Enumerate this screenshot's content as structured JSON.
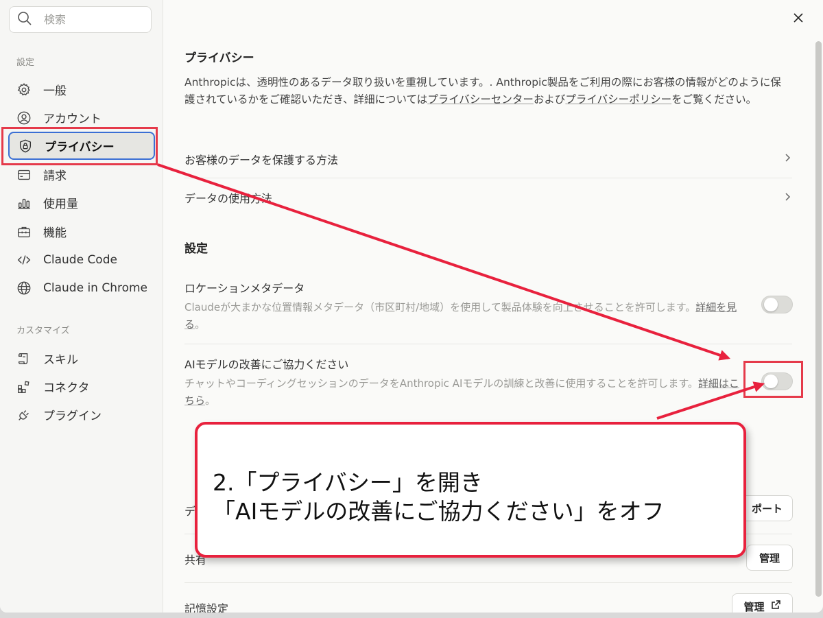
{
  "sidebar": {
    "search_placeholder": "検索",
    "section_settings": "設定",
    "items": [
      {
        "label": "一般"
      },
      {
        "label": "アカウント"
      },
      {
        "label": "プライバシー"
      },
      {
        "label": "請求"
      },
      {
        "label": "使用量"
      },
      {
        "label": "機能"
      },
      {
        "label": "Claude Code"
      },
      {
        "label": "Claude in Chrome"
      }
    ],
    "section_customize": "カスタマイズ",
    "custom_items": [
      {
        "label": "スキル"
      },
      {
        "label": "コネクタ"
      },
      {
        "label": "プラグイン"
      }
    ]
  },
  "privacy": {
    "title": "プライバシー",
    "intro_1": "Anthropicは、透明性のあるデータ取り扱いを重視しています。. Anthropic製品をご利用の際にお客様の情報がどのように保護されているかをご確認いただき、詳細については",
    "link_center": "プライバシーセンター",
    "intro_2": "および",
    "link_policy": "プライバシーポリシー",
    "intro_3": "をご覧ください。",
    "row_protect": "お客様のデータを保護する方法",
    "row_usage": "データの使用方法"
  },
  "settings": {
    "title": "設定",
    "location": {
      "title": "ロケーションメタデータ",
      "desc": "Claudeが大まかな位置情報メタデータ（市区町村/地域）を使用して製品体験を向上させることを許可します。",
      "link": "詳細を見る",
      "tail": "。"
    },
    "improve": {
      "title": "AIモデルの改善にご協力ください",
      "desc": "チャットやコーディングセッションのデータをAnthropic AIモデルの訓練と改善に使用することを許可します。",
      "link": "詳細はこちら",
      "tail": "。"
    }
  },
  "data_section": {
    "row_export_label": "デー",
    "export_button": "ポート",
    "row_shared_label": "共有",
    "manage_button": "管理",
    "row_memory_label": "記憶設定",
    "memory_button": "管理"
  },
  "annotation": {
    "line1": "2.「プライバシー」を開き",
    "line2": "「AIモデルの改善にご協力ください」をオフ"
  },
  "colors": {
    "annotation_red": "#e8213d",
    "active_border": "#3b6fd4"
  }
}
